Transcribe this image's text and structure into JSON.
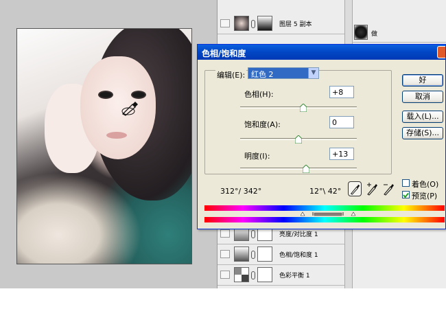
{
  "dialog": {
    "title": "色相/饱和度",
    "edit_label": "编辑(E):",
    "edit_value": "红色 2",
    "hue_label": "色相(H):",
    "hue_value": "+8",
    "saturation_label": "饱和度(A):",
    "saturation_value": "0",
    "lightness_label": "明度(I):",
    "lightness_value": "+13",
    "ok_label": "好",
    "cancel_label": "取消",
    "load_label": "载入(L)...",
    "save_label": "存储(S)...",
    "colorize_label": "着色(O)",
    "preview_label": "预览(P)",
    "colorize_checked": false,
    "preview_checked": true,
    "range_left": "312°/ 342°",
    "range_right": "12°\\ 42°"
  },
  "layers": {
    "top_layer": "图层 5 副本",
    "side_layer": "做",
    "bottom_layers": [
      "亮度/对比度 1",
      "色相/饱和度 1",
      "色彩平衡 1"
    ]
  },
  "colors": {
    "titlebar": "#0246c4",
    "dialog_bg": "#ece9d8",
    "selected": "#316ac5"
  },
  "icons": [
    "eye-icon",
    "chain-icon",
    "eyedropper-icon",
    "eyedropper-plus-icon",
    "eyedropper-minus-icon",
    "close-icon"
  ]
}
